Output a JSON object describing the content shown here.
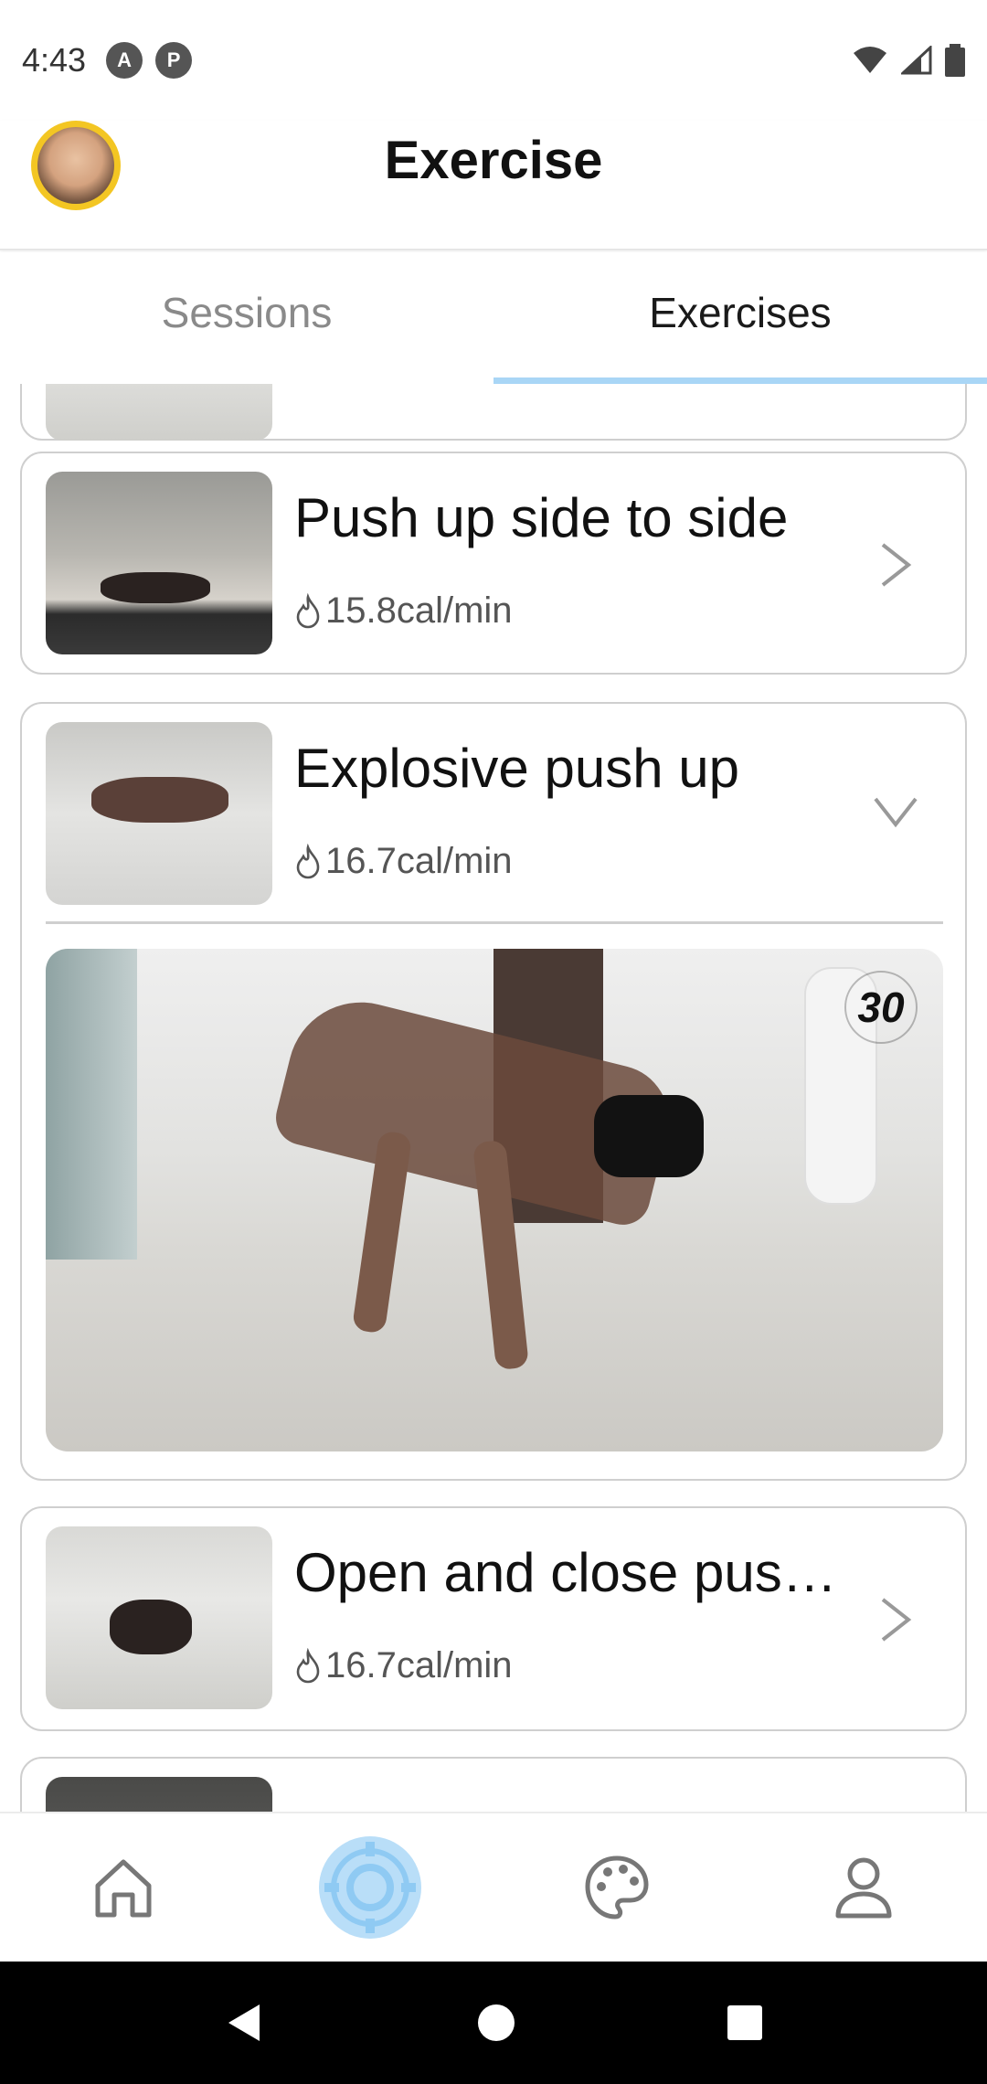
{
  "status_bar": {
    "time": "4:43",
    "app_icons": [
      "A",
      "P"
    ]
  },
  "header": {
    "title": "Exercise"
  },
  "tabs": [
    {
      "label": "Sessions",
      "active": false
    },
    {
      "label": "Exercises",
      "active": true
    }
  ],
  "exercises": [
    {
      "title": "Push up side to side",
      "calories": "15.8cal/min",
      "expanded": false
    },
    {
      "title": "Explosive push up",
      "calories": "16.7cal/min",
      "expanded": true,
      "video_timer": "30"
    },
    {
      "title": "Open and close pus…",
      "calories": "16.7cal/min",
      "expanded": false
    }
  ],
  "bottom_nav": [
    {
      "icon": "home-icon",
      "active": false
    },
    {
      "icon": "target-icon",
      "active": true
    },
    {
      "icon": "palette-icon",
      "active": false
    },
    {
      "icon": "profile-icon",
      "active": false
    }
  ],
  "colors": {
    "accent": "#a9d6f6",
    "avatar_ring": "#f3c623",
    "card_border": "#cfcfcf"
  }
}
